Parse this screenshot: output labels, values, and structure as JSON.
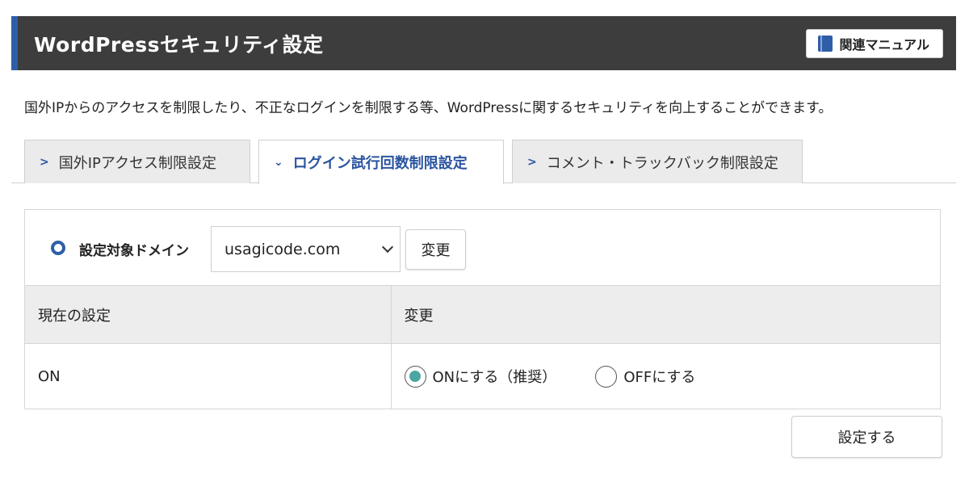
{
  "header": {
    "title": "WordPressセキュリティ設定",
    "manual_label": "関連マニュアル",
    "manual_icon": "book-icon"
  },
  "description": "国外IPからのアクセスを制限したり、不正なログインを制限する等、WordPressに関するセキュリティを向上することができます。",
  "tabs": [
    {
      "label": "国外IPアクセス制限設定",
      "active": false
    },
    {
      "label": "ログイン試行回数制限設定",
      "active": true
    },
    {
      "label": "コメント・トラックバック制限設定",
      "active": false
    }
  ],
  "domain": {
    "label": "設定対象ドメイン",
    "selected": "usagicode.com",
    "change_label": "変更"
  },
  "table": {
    "headers": [
      "現在の設定",
      "変更"
    ],
    "current_value": "ON",
    "options": [
      {
        "label": "ONにする（推奨）",
        "checked": true
      },
      {
        "label": "OFFにする",
        "checked": false
      }
    ]
  },
  "submit_label": "設定する",
  "colors": {
    "accent": "#2f5ea8",
    "header_bg": "#3d3d3d",
    "radio_checked": "#4aa6a0"
  }
}
